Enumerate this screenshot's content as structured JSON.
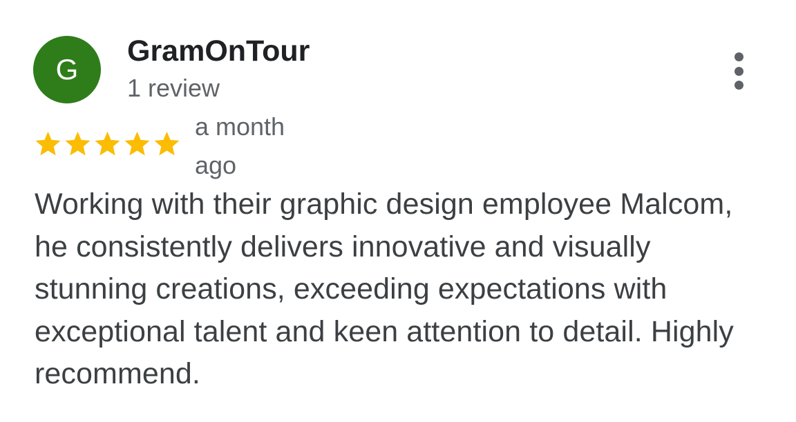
{
  "review": {
    "avatar": {
      "initial": "G",
      "color": "#2e7d1a"
    },
    "author_name": "GramOnTour",
    "review_count": "1 review",
    "menu_icon": "more-vert-icon",
    "rating": {
      "value": 5,
      "max": 5,
      "star_color": "#fbbc04",
      "icon": "star-icon"
    },
    "time_ago": "a month ago",
    "text": "Working with their graphic design employee Malcom, he consistently delivers innovative and visually stunning creations, exceeding expectations with exceptional talent and keen attention to detail. Highly recommend."
  }
}
